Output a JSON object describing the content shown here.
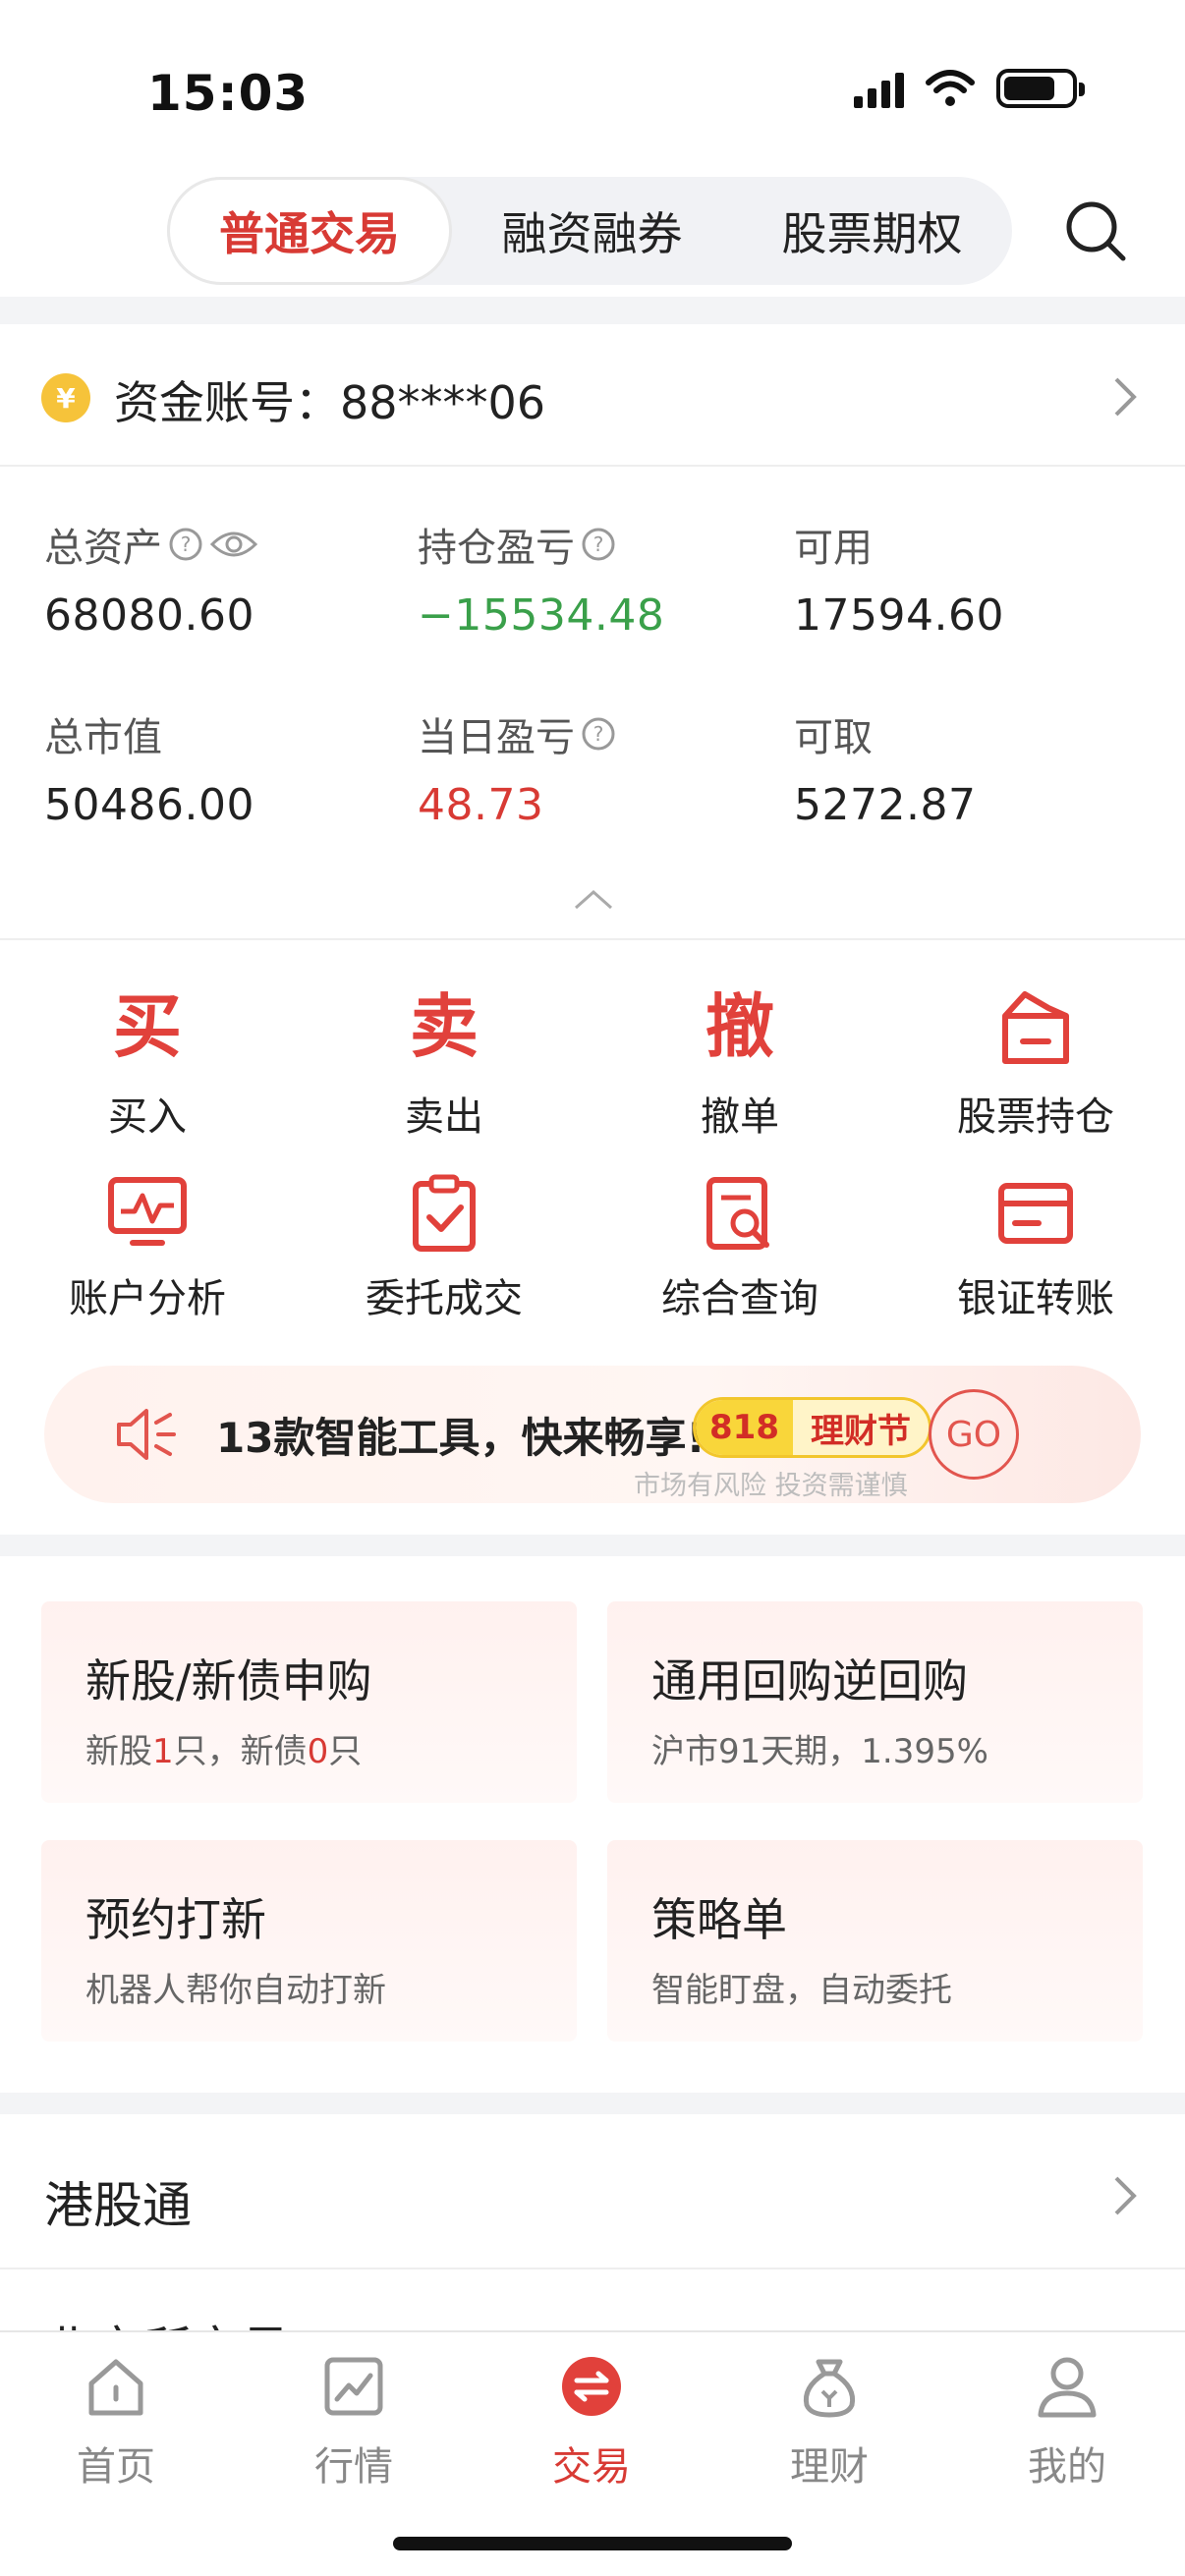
{
  "status_bar": {
    "time": "15:03"
  },
  "tabs": [
    {
      "label": "普通交易",
      "active": true
    },
    {
      "label": "融资融券",
      "active": false
    },
    {
      "label": "股票期权",
      "active": false
    }
  ],
  "account": {
    "coin_symbol": "¥",
    "label": "资金账号：88****06"
  },
  "assets": [
    {
      "label": "总资产",
      "value": "68080.60",
      "color": "#222222"
    },
    {
      "label": "持仓盈亏",
      "value": "−15534.48",
      "color": "#3aa04a"
    },
    {
      "label": "可用",
      "value": "17594.60",
      "color": "#222222"
    },
    {
      "label": "总市值",
      "value": "50486.00",
      "color": "#222222"
    },
    {
      "label": "当日盈亏",
      "value": "48.73",
      "color": "#d83a34"
    },
    {
      "label": "可取",
      "value": "5272.87",
      "color": "#222222"
    }
  ],
  "menu": [
    {
      "glyph": "买",
      "label": "买入"
    },
    {
      "glyph": "卖",
      "label": "卖出"
    },
    {
      "glyph": "撤",
      "label": "撤单"
    },
    {
      "icon": "portfolio-icon",
      "label": "股票持仓"
    },
    {
      "icon": "analysis-icon",
      "label": "账户分析"
    },
    {
      "icon": "clipboard-check-icon",
      "label": "委托成交"
    },
    {
      "icon": "doc-search-icon",
      "label": "综合查询"
    },
    {
      "icon": "card-transfer-icon",
      "label": "银证转账"
    }
  ],
  "promo": {
    "text": "13款智能工具，快来畅享!",
    "badge_num": "818",
    "badge_word": "理财节",
    "go": "GO",
    "note": "市场有风险 投资需谨慎"
  },
  "cards": [
    {
      "title": "新股/新债申购",
      "sub_parts": [
        "新股",
        "1",
        "只，新债",
        "0",
        "只"
      ]
    },
    {
      "title": "通用回购逆回购",
      "sub": "沪市91天期，1.395%"
    },
    {
      "title": "预约打新",
      "sub": "机器人帮你自动打新"
    },
    {
      "title": "策略单",
      "sub": "智能盯盘，自动委托"
    }
  ],
  "list": {
    "hk_label": "港股通",
    "peek_label": "北交所交易"
  },
  "bottom_nav": [
    {
      "label": "首页",
      "icon": "home-icon",
      "active": false
    },
    {
      "label": "行情",
      "icon": "chart-icon",
      "active": false
    },
    {
      "label": "交易",
      "icon": "trade-icon",
      "active": true
    },
    {
      "label": "理财",
      "icon": "money-bag-icon",
      "active": false
    },
    {
      "label": "我的",
      "icon": "user-icon",
      "active": false
    }
  ],
  "colors": {
    "accent": "#d83a34",
    "loss": "#3aa04a",
    "gain": "#d83a34"
  }
}
